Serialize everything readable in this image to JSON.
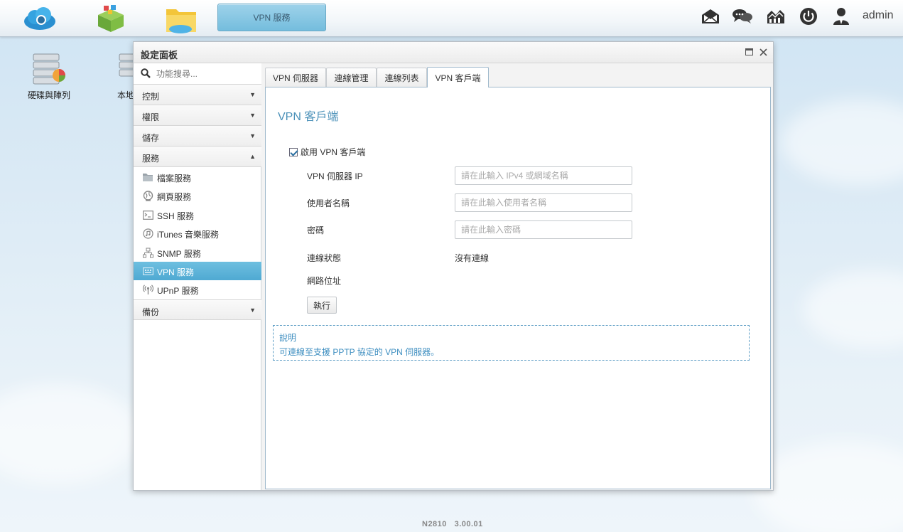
{
  "taskbar": {
    "active_app_label": "VPN 服務",
    "user_label": "admin"
  },
  "desktop": {
    "icons": [
      {
        "label": "硬碟與陣列"
      },
      {
        "label": "本地"
      }
    ],
    "model": "N2810",
    "version": "3.00.01"
  },
  "window": {
    "title": "設定面板"
  },
  "sidebar": {
    "search_placeholder": "功能搜尋...",
    "categories": {
      "control": "控制",
      "privilege": "權限",
      "storage": "儲存",
      "services": "服務",
      "backup": "備份"
    },
    "services_items": [
      {
        "label": "檔案服務",
        "icon": "folder-icon"
      },
      {
        "label": "網頁服務",
        "icon": "globe-icon"
      },
      {
        "label": "SSH 服務",
        "icon": "terminal-icon"
      },
      {
        "label": "iTunes 音樂服務",
        "icon": "music-icon"
      },
      {
        "label": "SNMP 服務",
        "icon": "network-icon"
      },
      {
        "label": "VPN 服務",
        "icon": "vpn-icon"
      },
      {
        "label": "UPnP 服務",
        "icon": "antenna-icon"
      }
    ]
  },
  "tabs": [
    {
      "label": "VPN 伺服器"
    },
    {
      "label": "連線管理"
    },
    {
      "label": "連線列表"
    },
    {
      "label": "VPN 客戶端"
    }
  ],
  "content": {
    "heading": "VPN 客戶端",
    "enable_label": "啟用 VPN 客戶端",
    "fields": {
      "server_ip_label": "VPN 伺服器 IP",
      "server_ip_placeholder": "請在此輸入 IPv4 或網域名稱",
      "username_label": "使用者名稱",
      "username_placeholder": "請在此輸入使用者名稱",
      "password_label": "密碼",
      "password_placeholder": "請在此輸入密碼",
      "status_label": "連線狀態",
      "status_value": "沒有連線",
      "address_label": "網路位址"
    },
    "run_button": "執行",
    "description": {
      "heading": "說明",
      "body": "可連線至支援 PPTP 協定的 VPN 伺服器。"
    }
  }
}
